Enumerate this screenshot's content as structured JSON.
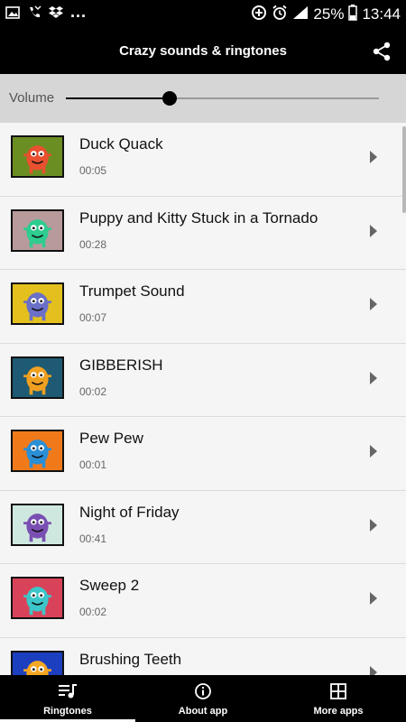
{
  "status_bar": {
    "dots": "...",
    "battery_text": "25%",
    "time": "13:44",
    "icons": [
      "image-icon",
      "missed-call-icon",
      "dropbox-icon",
      "data-saver-icon",
      "alarm-icon",
      "signal-icon",
      "battery-icon"
    ]
  },
  "app_bar": {
    "title": "Crazy sounds & ringtones",
    "share_icon": "share-icon"
  },
  "volume": {
    "label": "Volume",
    "level": 0.33
  },
  "sounds": [
    {
      "title": "Duck Quack",
      "duration": "00:05",
      "thumb_bg": "#6b8e23",
      "monster_color": "#e8502f"
    },
    {
      "title": "Puppy and Kitty Stuck in a Tornado",
      "duration": "00:28",
      "thumb_bg": "#b89a9a",
      "monster_color": "#2ecc8f"
    },
    {
      "title": "Trumpet Sound",
      "duration": "00:07",
      "thumb_bg": "#e3c01e",
      "monster_color": "#6a6fc7"
    },
    {
      "title": "GIBBERISH",
      "duration": "00:02",
      "thumb_bg": "#1e5a73",
      "monster_color": "#f0a020"
    },
    {
      "title": "Pew Pew",
      "duration": "00:01",
      "thumb_bg": "#f07a1a",
      "monster_color": "#2b8fd6"
    },
    {
      "title": "Night of Friday",
      "duration": "00:41",
      "thumb_bg": "#cfe8df",
      "monster_color": "#7a4fb3"
    },
    {
      "title": "Sweep 2",
      "duration": "00:02",
      "thumb_bg": "#d9435a",
      "monster_color": "#3dc6c9"
    },
    {
      "title": "Brushing Teeth",
      "duration": "",
      "thumb_bg": "#1c3fbf",
      "monster_color": "#f5a623"
    }
  ],
  "bottom_nav": [
    {
      "label": "Ringtones",
      "icon": "music-list-icon",
      "active": true
    },
    {
      "label": "About app",
      "icon": "info-icon",
      "active": false
    },
    {
      "label": "More apps",
      "icon": "grid-icon",
      "active": false
    }
  ]
}
